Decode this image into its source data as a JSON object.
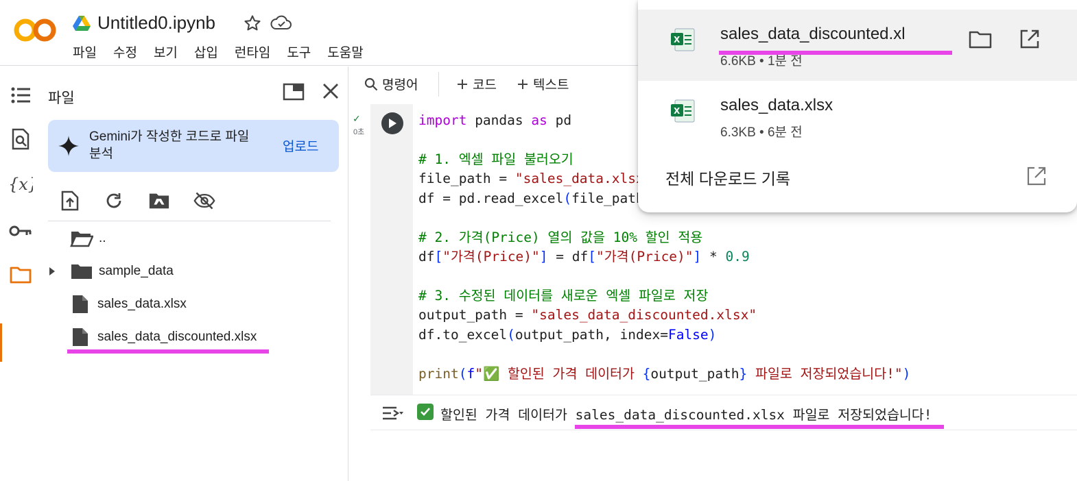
{
  "header": {
    "notebook_title": "Untitled0.ipynb",
    "menu": [
      "파일",
      "수정",
      "보기",
      "삽입",
      "런타임",
      "도구",
      "도움말"
    ]
  },
  "files_panel": {
    "title": "파일",
    "gemini_text": "Gemini가 작성한 코드로 파일 분석",
    "upload_label": "업로드",
    "tree": [
      {
        "label": "..",
        "type": "folder-open"
      },
      {
        "label": "sample_data",
        "type": "folder"
      },
      {
        "label": "sales_data.xlsx",
        "type": "file"
      },
      {
        "label": "sales_data_discounted.xlsx",
        "type": "file"
      }
    ]
  },
  "toolbar": {
    "command_label": "명령어",
    "code_label": "코드",
    "text_label": "텍스트"
  },
  "cell": {
    "exec_time": "0초",
    "code_lines": [
      "import pandas as pd",
      "",
      "# 1. 엑셀 파일 불러오기",
      "file_path = \"sales_data.xlsx\"",
      "df = pd.read_excel(file_path)",
      "",
      "# 2. 가격(Price) 열의 값을 10% 할인 적용",
      "df[\"가격(Price)\"] = df[\"가격(Price)\"] * 0.9",
      "",
      "# 3. 수정된 데이터를 새로운 엑셀 파일로 저장",
      "output_path = \"sales_data_discounted.xlsx\"",
      "df.to_excel(output_path, index=False)",
      "",
      "print(f\"✅ 할인된 가격 데이터가 {output_path} 파일로 저장되었습니다!\")"
    ],
    "output_text": "할인된 가격 데이터가 sales_data_discounted.xlsx 파일로 저장되었습니다!"
  },
  "downloads": {
    "items": [
      {
        "name": "sales_data_discounted.xlsx",
        "meta": "6.6KB • 1분 전"
      },
      {
        "name": "sales_data.xlsx",
        "meta": "6.3KB • 6분 전"
      }
    ],
    "all_history_label": "전체 다운로드 기록"
  },
  "colors": {
    "highlight_underline": "#e845e8",
    "accent_orange": "#e8710a",
    "gemini_bg": "#d3e3fd",
    "link_blue": "#0b57d0"
  }
}
